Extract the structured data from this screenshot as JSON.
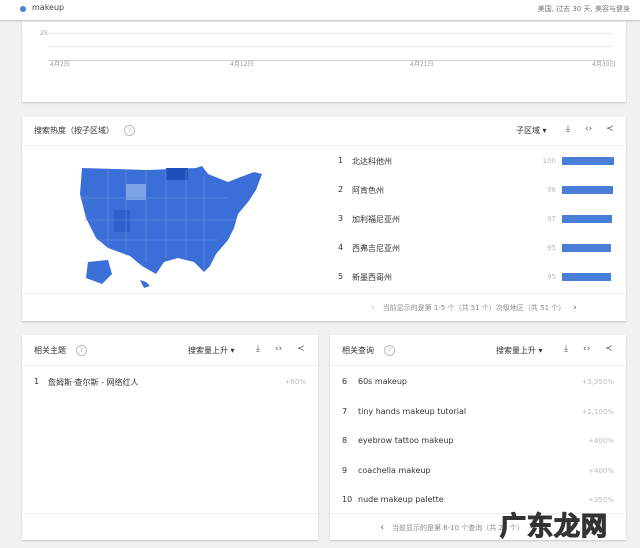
{
  "topbar": {
    "term": "makeup",
    "term_color": "#4a7fd8",
    "filters": "美国, 过去 30 天, 美容与健身"
  },
  "timeline": {
    "y_tick": "25",
    "x_ticks": [
      "4月2日",
      "4月12日",
      "4月21日",
      "4月30日"
    ]
  },
  "region": {
    "title": "搜索热度（按子区域）",
    "selector": "子区域",
    "rows": [
      {
        "rank": "1",
        "name": "北达科他州",
        "value": 100
      },
      {
        "rank": "2",
        "name": "阿肯色州",
        "value": 98
      },
      {
        "rank": "3",
        "name": "加利福尼亚州",
        "value": 97
      },
      {
        "rank": "4",
        "name": "西弗吉尼亚州",
        "value": 95
      },
      {
        "rank": "5",
        "name": "新墨西哥州",
        "value": 95
      }
    ],
    "pager": "当前显示的是第 1-5 个（共 51 个）次级地区（共 51 个）",
    "bar_color": "#4a7fd8",
    "map_color": "#3a6fd8"
  },
  "topics": {
    "title": "相关主题",
    "selector": "搜索量上升",
    "items": [
      {
        "rank": "1",
        "name": "詹姆斯·查尔斯 - 网络红人",
        "value": "+60%"
      }
    ]
  },
  "queries": {
    "title": "相关查询",
    "selector": "搜索量上升",
    "items": [
      {
        "rank": "6",
        "name": "60s makeup",
        "value": "+3,350%"
      },
      {
        "rank": "7",
        "name": "tiny hands makeup tutorial",
        "value": "+2,100%"
      },
      {
        "rank": "8",
        "name": "eyebrow tattoo makeup",
        "value": "+400%"
      },
      {
        "rank": "9",
        "name": "coachella makeup",
        "value": "+400%"
      },
      {
        "rank": "10",
        "name": "nude makeup palette",
        "value": "+350%"
      }
    ],
    "pager": "当前显示的是第 6-10 个查询（共 25 个）"
  },
  "watermark": "广东龙网"
}
